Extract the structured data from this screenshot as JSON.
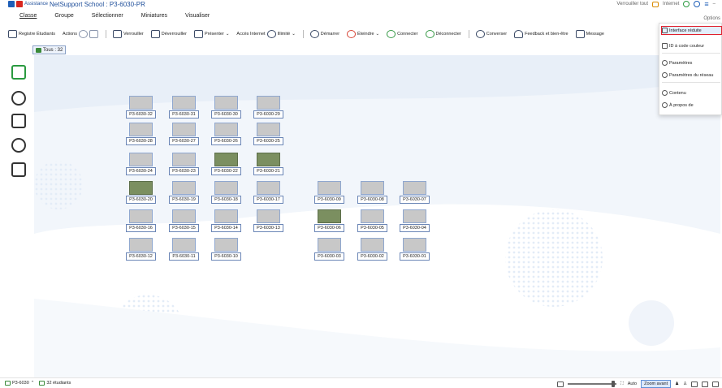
{
  "titlebar": {
    "assist_label": "Assistance",
    "title": "NetSupport School : P3-6030-PR",
    "lock_all": "Verrouiller tout",
    "internet": "Internet"
  },
  "menu": {
    "items": [
      "Classe",
      "Groupe",
      "Sélectionner",
      "Miniatures",
      "Visualiser"
    ],
    "active": "Classe",
    "options": "Options"
  },
  "toolbar": {
    "register": "Registre Étudiants",
    "actions": "Actions",
    "lock": "Verrouiller",
    "unlock": "Déverrouiller",
    "present": "Présenter",
    "internet_access": "Accès Internet",
    "unlimited": "Illimité",
    "start": "Démarrer",
    "shutdown": "Éteindre",
    "connect": "Connecter",
    "disconnect": "Déconnecter",
    "chat": "Converser",
    "feedback": "Feedback et bien-être",
    "message": "Message"
  },
  "tab_all": "Tous : 32",
  "dropdown": {
    "reduced": "Interface réduite",
    "color_id": "ID à code couleur",
    "params": "Paramètres",
    "net_params": "Paramètres du réseau",
    "content": "Contenu",
    "about": "À propos de"
  },
  "students": [
    {
      "name": "P3-6030-32",
      "live": false
    },
    {
      "name": "P3-6030-31",
      "live": false
    },
    {
      "name": "P3-6030-30",
      "live": false
    },
    {
      "name": "P3-6030-29",
      "live": false
    },
    {
      "name": "P3-6030-28",
      "live": false
    },
    {
      "name": "P3-6030-27",
      "live": false
    },
    {
      "name": "P3-6030-26",
      "live": false
    },
    {
      "name": "P3-6030-25",
      "live": false
    },
    {
      "name": "P3-6030-24",
      "live": false
    },
    {
      "name": "P3-6030-23",
      "live": false
    },
    {
      "name": "P3-6030-22",
      "live": true
    },
    {
      "name": "P3-6030-21",
      "live": true
    },
    {
      "name": "P3-6030-20",
      "live": true
    },
    {
      "name": "P3-6030-19",
      "live": false
    },
    {
      "name": "P3-6030-18",
      "live": false
    },
    {
      "name": "P3-6030-17",
      "live": false
    },
    {
      "name": "P3-6030-09",
      "live": false
    },
    {
      "name": "P3-6030-08",
      "live": false
    },
    {
      "name": "P3-6030-07",
      "live": false
    },
    {
      "name": "P3-6030-16",
      "live": false
    },
    {
      "name": "P3-6030-15",
      "live": false
    },
    {
      "name": "P3-6030-14",
      "live": false
    },
    {
      "name": "P3-6030-13",
      "live": false
    },
    {
      "name": "P3-6030-06",
      "live": true
    },
    {
      "name": "P3-6030-05",
      "live": false
    },
    {
      "name": "P3-6030-04",
      "live": false
    },
    {
      "name": "P3-6030-12",
      "live": false
    },
    {
      "name": "P3-6030-11",
      "live": false
    },
    {
      "name": "P3-6030-10",
      "live": false
    },
    {
      "name": "P3-6030-03",
      "live": false
    },
    {
      "name": "P3-6030-02",
      "live": false
    },
    {
      "name": "P3-6030-01",
      "live": false
    }
  ],
  "statusbar": {
    "room": "P3-6030",
    "students": "32 étudiants",
    "auto": "Auto",
    "zoom": "Zoom avant"
  },
  "colors": {
    "accent": "#1f5fb8",
    "highlight_border": "#e0202e",
    "active_green": "#2a9a40"
  }
}
